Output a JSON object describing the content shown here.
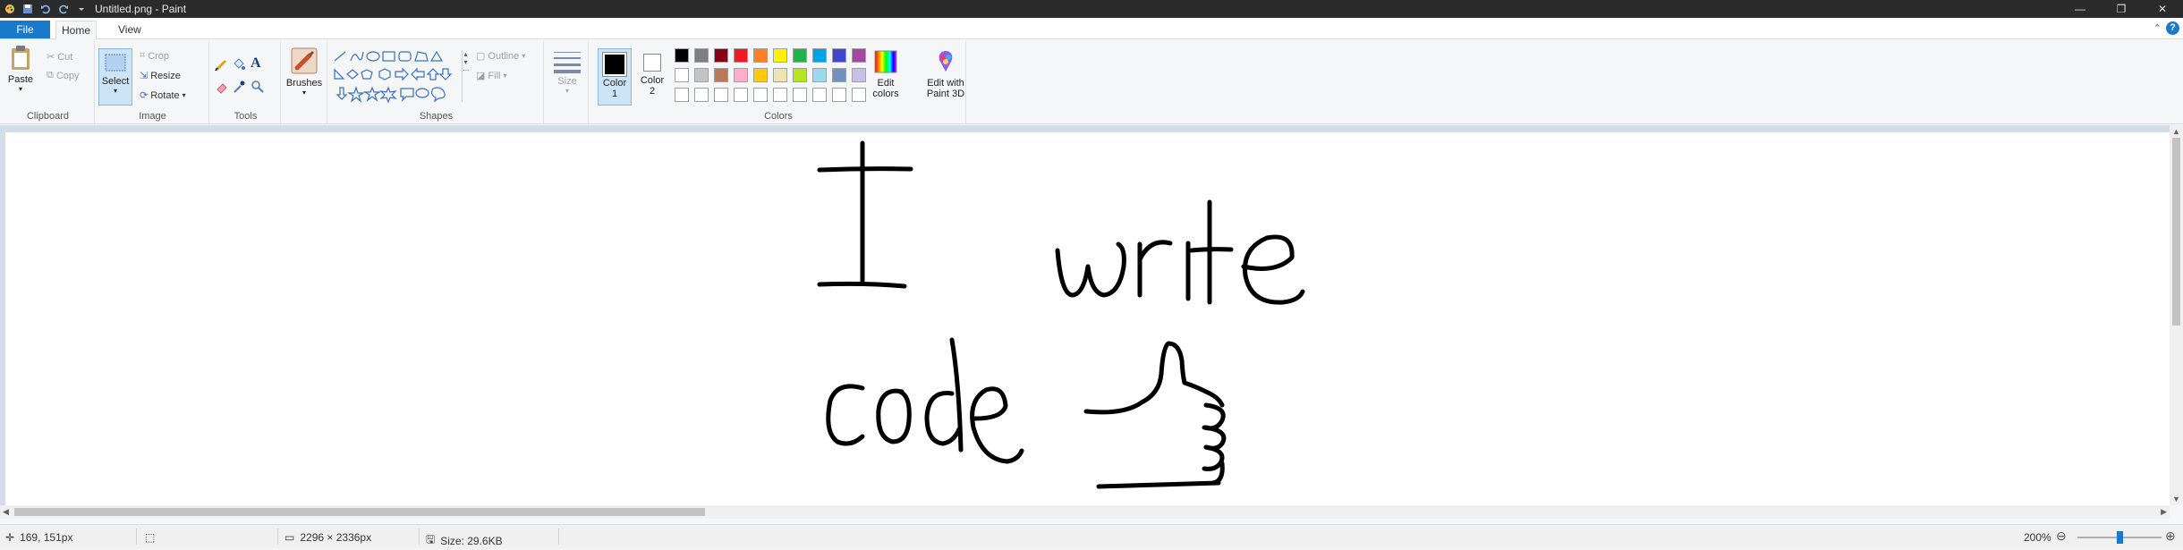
{
  "window": {
    "title": "Untitled.png - Paint"
  },
  "window_controls": {
    "minimize": "—",
    "maximize": "❐",
    "close": "✕"
  },
  "tabs": {
    "file": "File",
    "home": "Home",
    "view": "View"
  },
  "ribbon": {
    "clipboard": {
      "label": "Clipboard",
      "paste": "Paste",
      "cut": "Cut",
      "copy": "Copy"
    },
    "image": {
      "label": "Image",
      "select": "Select",
      "crop": "Crop",
      "resize": "Resize",
      "rotate": "Rotate"
    },
    "tools": {
      "label": "Tools"
    },
    "brushes": {
      "label": "Brushes"
    },
    "shapes": {
      "label": "Shapes",
      "outline": "Outline",
      "fill": "Fill"
    },
    "size": {
      "label": "Size"
    },
    "colors": {
      "label": "Colors",
      "color1": "Color",
      "color1_num": "1",
      "color2": "Color",
      "color2_num": "2",
      "edit_colors_1": "Edit",
      "edit_colors_2": "colors",
      "paint3d_1": "Edit with",
      "paint3d_2": "Paint 3D",
      "palette_row1": [
        "#000000",
        "#7f7f7f",
        "#880015",
        "#ed1c24",
        "#ff7f27",
        "#fff200",
        "#22b14c",
        "#00a2e8",
        "#3f48cc",
        "#a349a4"
      ],
      "palette_row2": [
        "#ffffff",
        "#c3c3c3",
        "#b97a57",
        "#ffaec9",
        "#ffc90e",
        "#efe4b0",
        "#b5e61d",
        "#99d9ea",
        "#7092be",
        "#c8bfe7"
      ],
      "palette_row3": [
        "#ffffff",
        "#ffffff",
        "#ffffff",
        "#ffffff",
        "#ffffff",
        "#ffffff",
        "#ffffff",
        "#ffffff",
        "#ffffff",
        "#ffffff"
      ]
    }
  },
  "canvas": {
    "drawing": "I write code 👍 (handwritten)"
  },
  "status": {
    "cursor_pos": "169, 151px",
    "image_size": "2296 × 2336px",
    "file_size": "Size: 29.6KB",
    "zoom": "200%"
  }
}
